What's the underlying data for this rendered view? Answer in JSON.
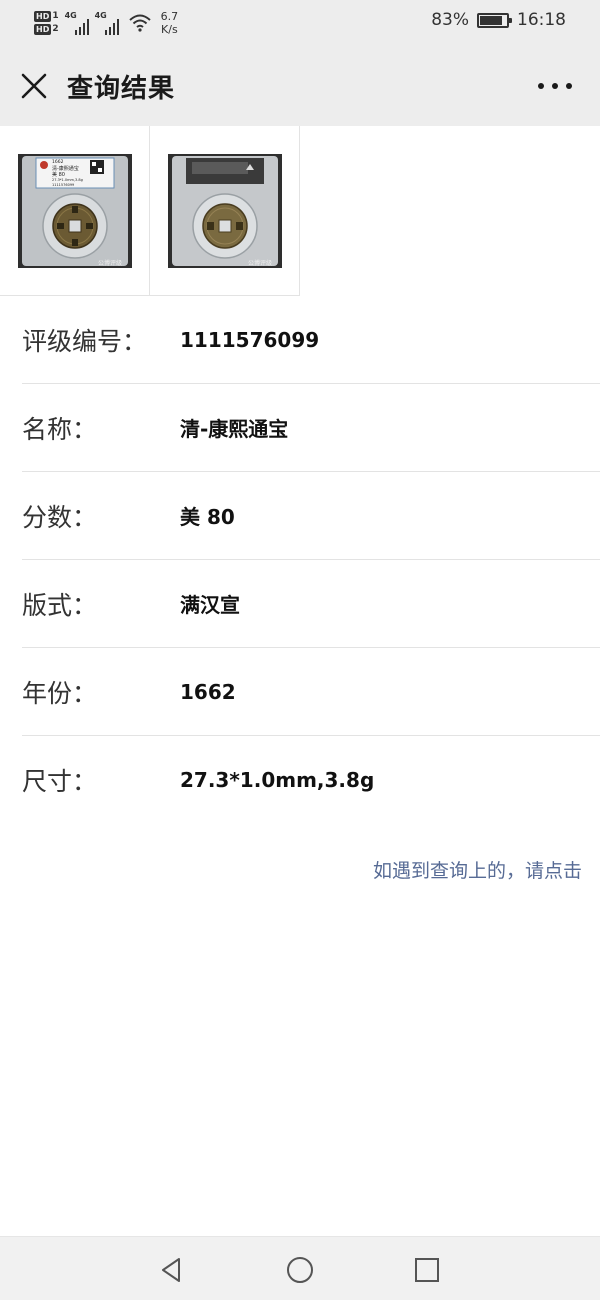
{
  "status_bar": {
    "hd1": "HD",
    "hd1_sub": "1",
    "hd2": "HD",
    "hd2_sub": "2",
    "net1": "4G",
    "net2": "4G",
    "speed_value": "6.7",
    "speed_unit": "K/s",
    "battery_percent": "83%",
    "battery_level": 0.83,
    "time": "16:18",
    "icons": [
      "signal-icon",
      "wifi-icon",
      "battery-icon"
    ]
  },
  "header": {
    "title": "查询结果",
    "close_icon": "close-icon",
    "more_icon": "more-icon"
  },
  "images": [
    {
      "name": "coin-front-image",
      "watermark": "公博评级",
      "slab_text": [
        "1662",
        "清-康熙通宝",
        "美 80",
        "27.3*1.0mm,3.8g",
        "1111576099"
      ]
    },
    {
      "name": "coin-back-image",
      "watermark": "公博评级"
    }
  ],
  "details": [
    {
      "key": "grading-number",
      "label": "评级编号：",
      "value": "1111576099"
    },
    {
      "key": "name",
      "label": "名称：",
      "value": "清-康熙通宝"
    },
    {
      "key": "score",
      "label": "分数：",
      "value": "美 80"
    },
    {
      "key": "variety",
      "label": "版式：",
      "value": "满汉宣"
    },
    {
      "key": "year",
      "label": "年份：",
      "value": "1662"
    },
    {
      "key": "size",
      "label": "尺寸：",
      "value": "27.3*1.0mm,3.8g"
    }
  ],
  "report_link": "如遇到查询上的，请点击",
  "colors": {
    "header_bg": "#ededed",
    "link": "#576b95",
    "divider": "#e3e3e3",
    "nav_bg": "#f1f1f1"
  },
  "nav_bar": {
    "icons": [
      "back-icon",
      "home-icon",
      "recents-icon"
    ]
  }
}
